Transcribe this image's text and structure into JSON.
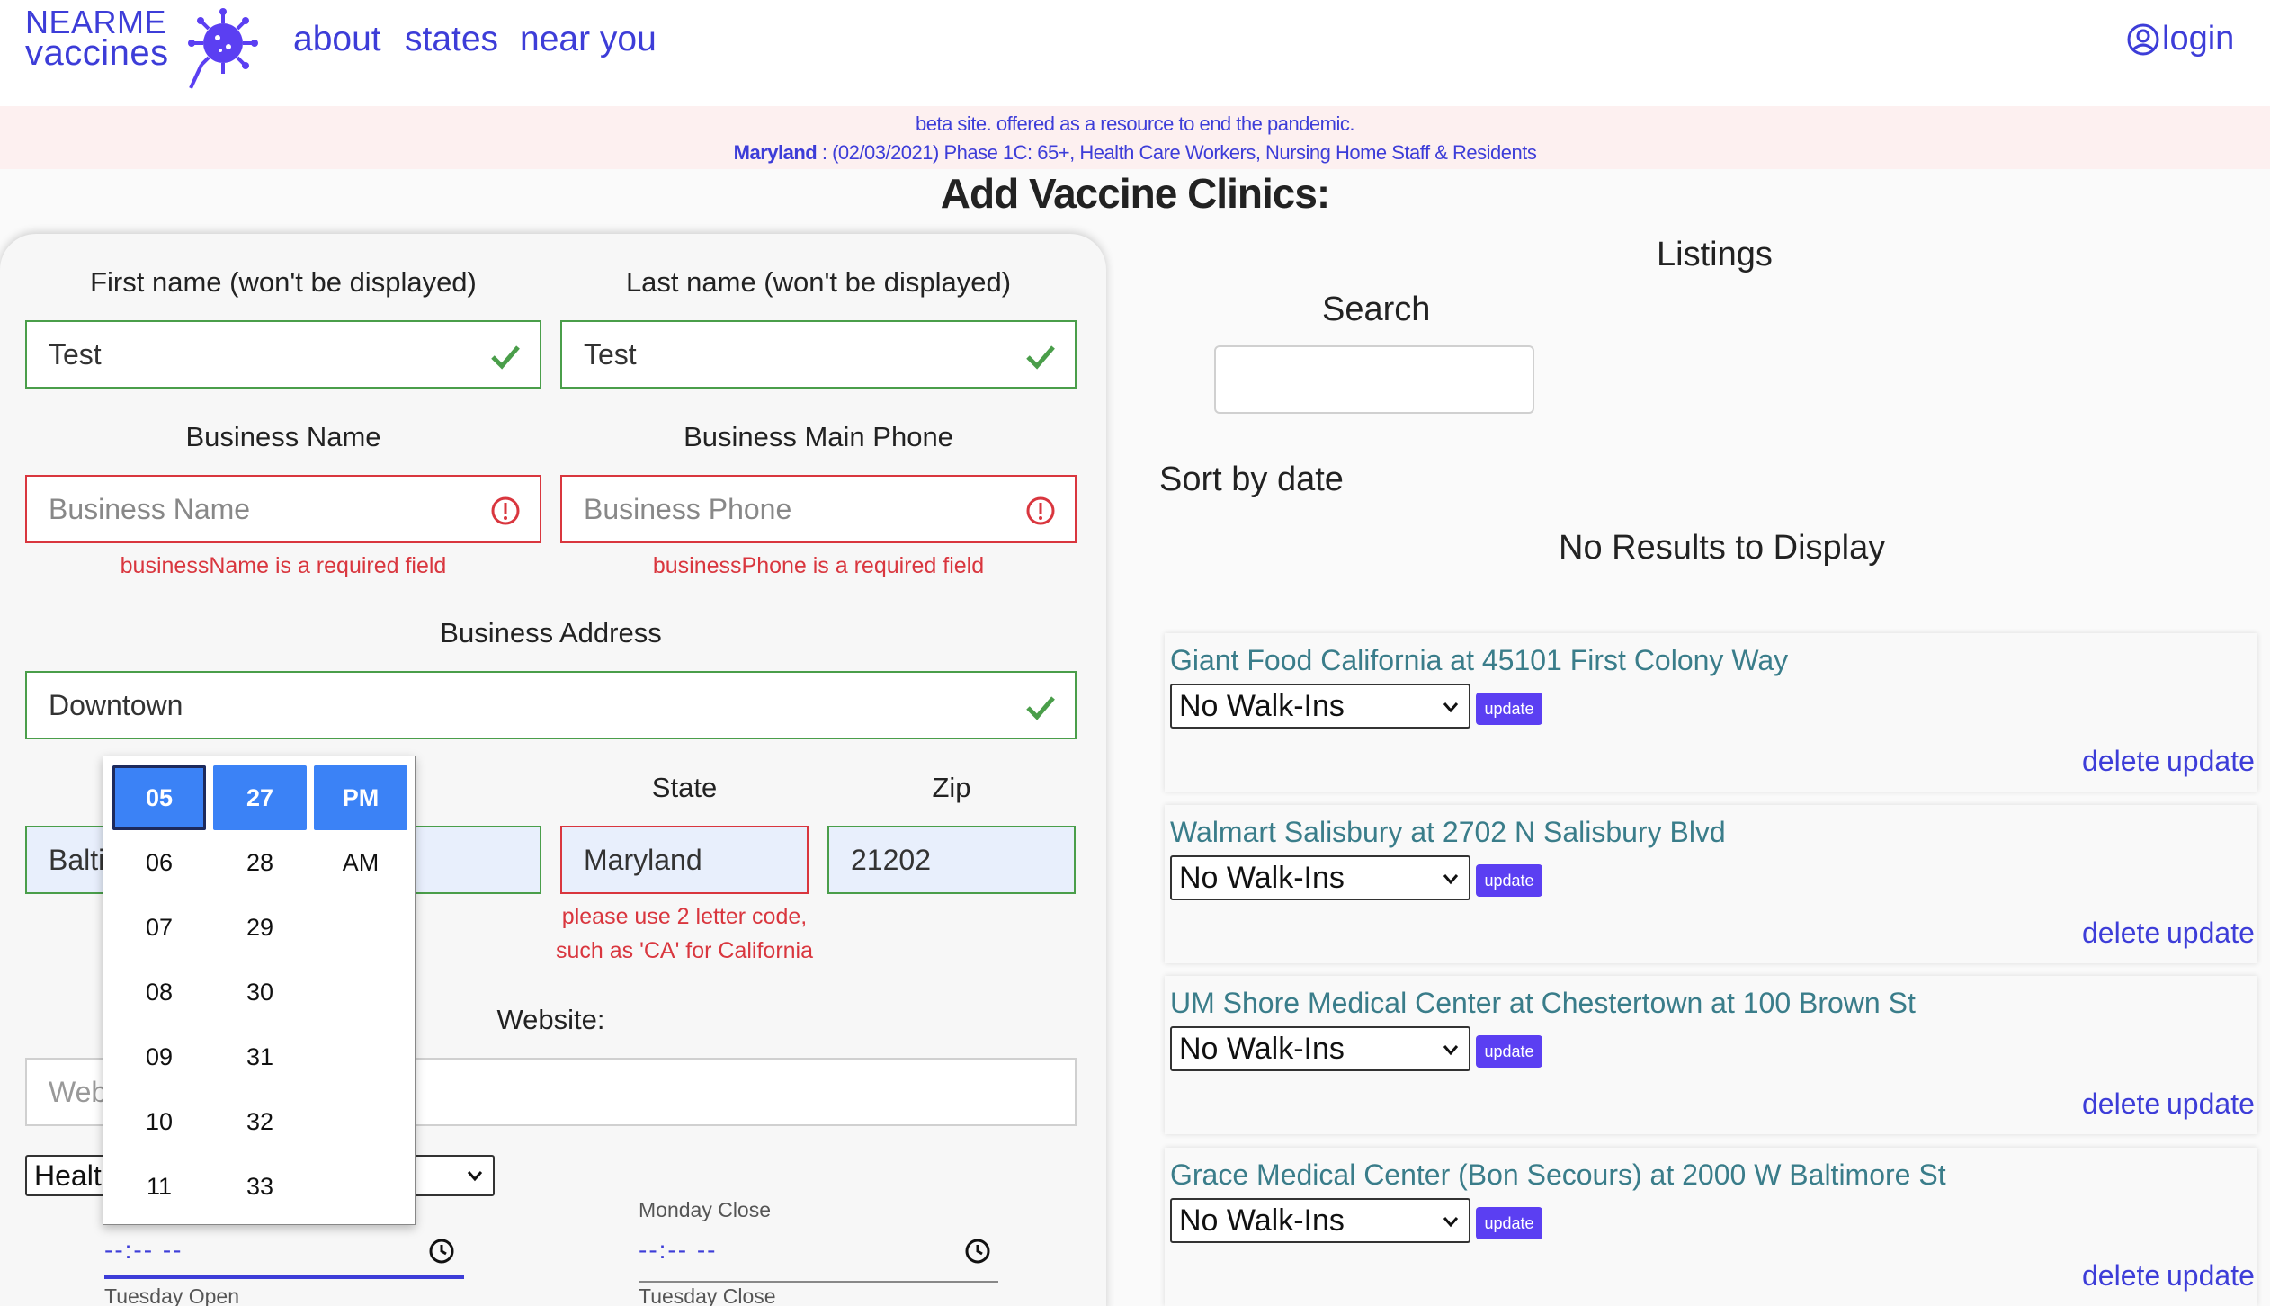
{
  "header": {
    "logo_line1": "NEARME",
    "logo_line2": "vaccines",
    "nav": [
      "about",
      "states",
      "near you"
    ],
    "login": "login"
  },
  "banner": {
    "line1": "beta site. offered as a resource to end the pandemic.",
    "state": "Maryland",
    "line2": " : (02/03/2021) Phase 1C: 65+, Health Care Workers, Nursing Home Staff & Residents"
  },
  "page_title": "Add Vaccine Clinics:",
  "form": {
    "first_name_label": "First name (won't be displayed)",
    "first_name_value": "Test",
    "last_name_label": "Last name (won't be displayed)",
    "last_name_value": "Test",
    "business_name_label": "Business Name",
    "business_name_placeholder": "Business Name",
    "business_name_error": "businessName is a required field",
    "business_phone_label": "Business Main Phone",
    "business_phone_placeholder": "Business Phone",
    "business_phone_error": "businessPhone is a required field",
    "address_label": "Business Address",
    "address_value": "Downtown",
    "city_value": "Balti",
    "state_label": "State",
    "state_value": "Maryland",
    "state_error_line1": "please use 2 letter code,",
    "state_error_line2": "such as 'CA' for California",
    "zip_label": "Zip",
    "zip_value": "21202",
    "website_label": "Website:",
    "website_placeholder": "Web",
    "type_select_value": "Healt",
    "monday_open_value": "--:-- --",
    "monday_close_label": "Monday Close",
    "monday_close_value": "--:-- --",
    "tuesday_open_label": "Tuesday Open",
    "tuesday_close_label": "Tuesday Close"
  },
  "time_picker": {
    "hours": [
      "05",
      "06",
      "07",
      "08",
      "09",
      "10",
      "11"
    ],
    "minutes": [
      "27",
      "28",
      "29",
      "30",
      "31",
      "32",
      "33"
    ],
    "ampm": [
      "PM",
      "AM"
    ]
  },
  "listings": {
    "title": "Listings",
    "search_label": "Search",
    "sort_label": "Sort by date",
    "no_results": "No Results to Display",
    "items": [
      {
        "name": "Giant Food California at 45101 First Colony Way",
        "walkin": "No Walk-Ins",
        "btn": "update",
        "delete": "delete",
        "update": "update"
      },
      {
        "name": "Walmart Salisbury at 2702 N Salisbury Blvd",
        "walkin": "No Walk-Ins",
        "btn": "update",
        "delete": "delete",
        "update": "update"
      },
      {
        "name": "UM Shore Medical Center at Chestertown at 100 Brown St",
        "walkin": "No Walk-Ins",
        "btn": "update",
        "delete": "delete",
        "update": "update"
      },
      {
        "name": "Grace Medical Center (Bon Secours) at 2000 W Baltimore St",
        "walkin": "No Walk-Ins",
        "btn": "update",
        "delete": "delete",
        "update": "update"
      }
    ]
  },
  "colors": {
    "brand": "#3d3dd8",
    "valid": "#4a9e4a",
    "error": "#d9363e",
    "picker_selected": "#3b82f6",
    "listing_title": "#3a7d8a",
    "update_button": "#5b3ff2"
  }
}
